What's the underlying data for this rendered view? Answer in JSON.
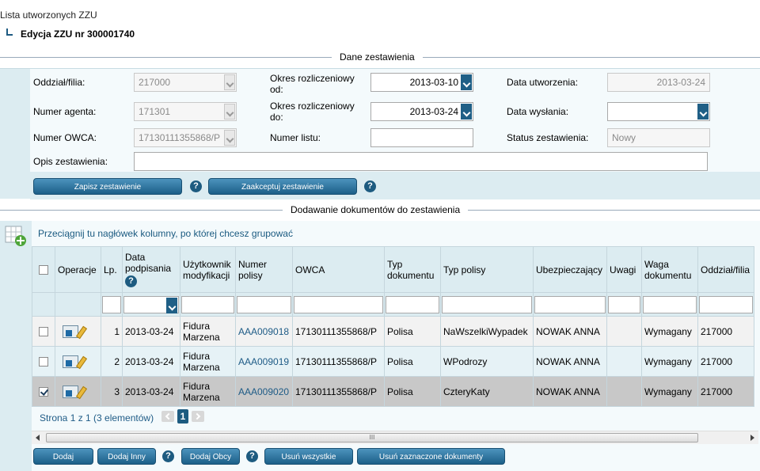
{
  "breadcrumb": {
    "root": "Lista utworzonych ZZU",
    "current": "Edycja ZZU nr 300001740"
  },
  "section_form_title": "Dane zestawienia",
  "section_grid_title": "Dodawanie dokumentów do zestawienia",
  "form": {
    "oddzial_label": "Oddział/filia:",
    "oddzial_value": "217000",
    "agent_label": "Numer agenta:",
    "agent_value": "171301",
    "owca_label": "Numer OWCA:",
    "owca_value": "17130111355868/P",
    "opis_label": "Opis zestawienia:",
    "opis_value": "",
    "okres_od_label": "Okres rozliczeniowy od:",
    "okres_od_value": "2013-03-10",
    "okres_do_label": "Okres rozliczeniowy do:",
    "okres_do_value": "2013-03-24",
    "numer_listu_label": "Numer listu:",
    "numer_listu_value": "",
    "data_utworzenia_label": "Data utworzenia:",
    "data_utworzenia_value": "2013-03-24",
    "data_wyslania_label": "Data wysłania:",
    "data_wyslania_value": "",
    "status_label": "Status zestawienia:",
    "status_value": "Nowy"
  },
  "form_buttons": {
    "save": "Zapisz zestawienie",
    "accept": "Zaakceptuj zestawienie",
    "help": "?"
  },
  "grid": {
    "group_hint": "Przeciągnij tu nagłówek kolumny, po której chcesz grupować",
    "columns": [
      "",
      "Operacje",
      "Lp.",
      "Data podpisania",
      "Użytkownik modyfikacji",
      "Numer polisy",
      "OWCA",
      "Typ dokumentu",
      "Typ polisy",
      "Ubezpieczający",
      "Uwagi",
      "Waga dokumentu",
      "Oddział/filia"
    ],
    "rows": [
      {
        "checked": false,
        "lp": "1",
        "data": "2013-03-24",
        "user": "Fidura Marzena",
        "polisa": "AAA009018",
        "owca": "17130111355868/P",
        "typ_dok": "Polisa",
        "typ_polisy": "NaWszelkiWypadek",
        "ubezp": "NOWAK ANNA",
        "uwagi": "",
        "waga": "Wymagany",
        "oddzial": "217000"
      },
      {
        "checked": false,
        "lp": "2",
        "data": "2013-03-24",
        "user": "Fidura Marzena",
        "polisa": "AAA009019",
        "owca": "17130111355868/P",
        "typ_dok": "Polisa",
        "typ_polisy": "WPodrozy",
        "ubezp": "NOWAK ANNA",
        "uwagi": "",
        "waga": "Wymagany",
        "oddzial": "217000"
      },
      {
        "checked": true,
        "lp": "3",
        "data": "2013-03-24",
        "user": "Fidura Marzena",
        "polisa": "AAA009020",
        "owca": "17130111355868/P",
        "typ_dok": "Polisa",
        "typ_polisy": "CzteryKaty",
        "ubezp": "NOWAK ANNA",
        "uwagi": "",
        "waga": "Wymagany",
        "oddzial": "217000"
      }
    ],
    "pager_text": "Strona 1 z 1 (3 elementów)",
    "current_page": "1",
    "scroll_grip": "III"
  },
  "bottom_buttons": {
    "add": "Dodaj",
    "add_other": "Dodaj Inny",
    "add_foreign": "Dodaj Obcy",
    "remove_all": "Usuń wszystkie",
    "remove_selected": "Usuń zaznaczone dokumenty"
  }
}
